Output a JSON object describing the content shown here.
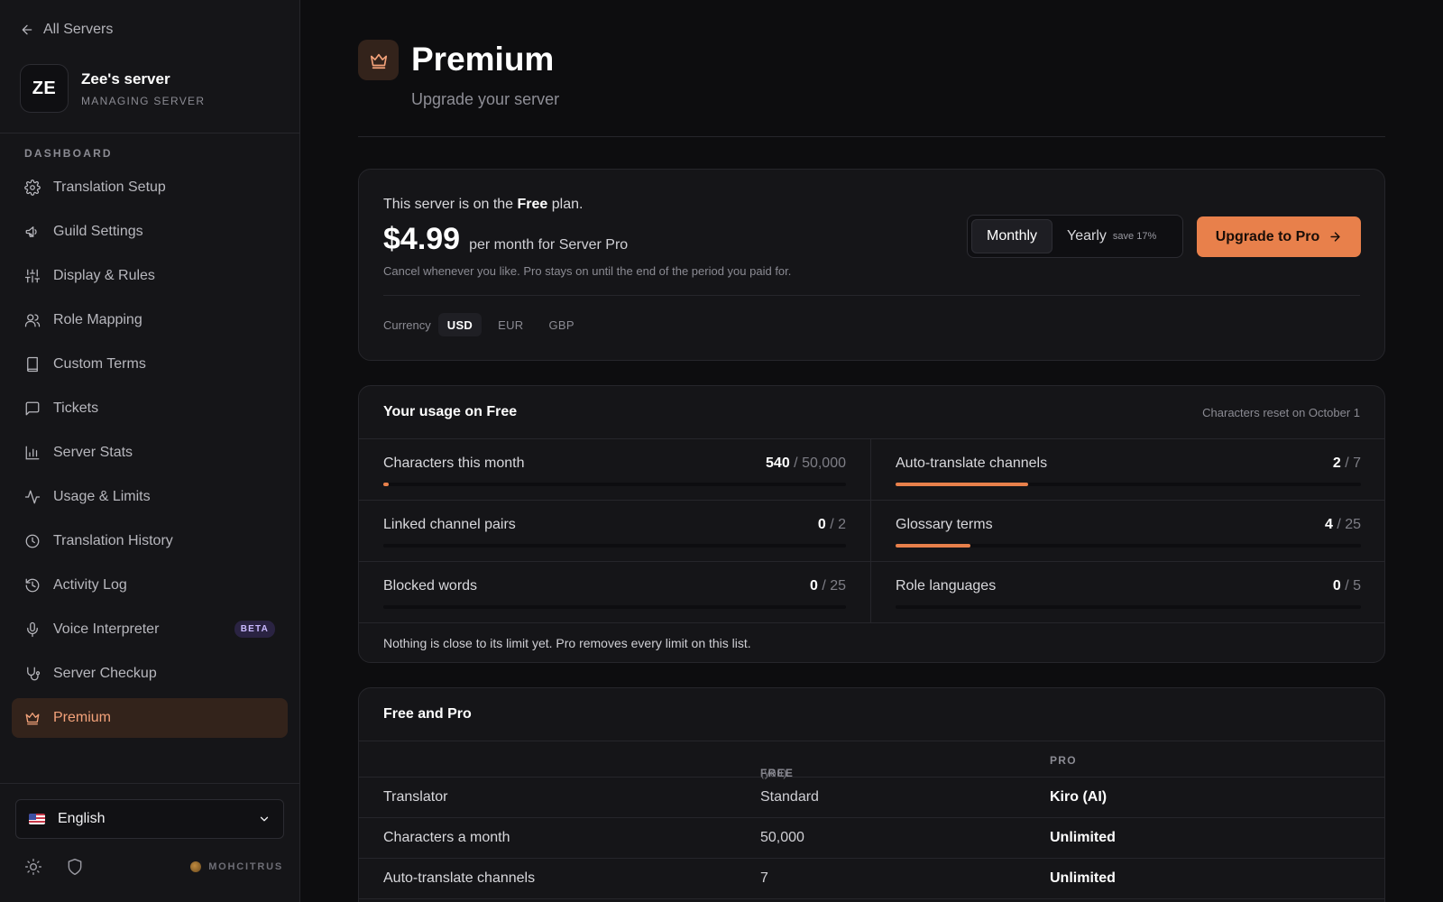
{
  "sidebar": {
    "back_label": "All Servers",
    "server_avatar": "ZE",
    "server_name": "Zee's server",
    "server_subtitle": "MANAGING SERVER",
    "section_label": "DASHBOARD",
    "items": [
      {
        "label": "Translation Setup",
        "icon": "gear-icon"
      },
      {
        "label": "Guild Settings",
        "icon": "megaphone-icon"
      },
      {
        "label": "Display & Rules",
        "icon": "sliders-icon"
      },
      {
        "label": "Role Mapping",
        "icon": "users-icon"
      },
      {
        "label": "Custom Terms",
        "icon": "book-icon"
      },
      {
        "label": "Tickets",
        "icon": "message-icon"
      },
      {
        "label": "Server Stats",
        "icon": "bar-chart-icon"
      },
      {
        "label": "Usage & Limits",
        "icon": "activity-icon"
      },
      {
        "label": "Translation History",
        "icon": "clock-icon"
      },
      {
        "label": "Activity Log",
        "icon": "history-icon"
      },
      {
        "label": "Voice Interpreter",
        "icon": "mic-icon",
        "badge": "BETA"
      },
      {
        "label": "Server Checkup",
        "icon": "stethoscope-icon"
      },
      {
        "label": "Premium",
        "icon": "crown-icon",
        "active": true
      }
    ],
    "language": "English",
    "brand": "MOHCITRUS"
  },
  "header": {
    "title": "Premium",
    "subtitle": "Upgrade your server"
  },
  "plan": {
    "line_prefix": "This server is on the ",
    "plan_name": "Free",
    "line_suffix": " plan.",
    "price": "$4.99",
    "price_note": "per month for Server Pro",
    "cancel_note": "Cancel whenever you like. Pro stays on until the end of the period you paid for.",
    "billing": {
      "monthly": "Monthly",
      "yearly": "Yearly",
      "save": "save 17%",
      "selected": "Monthly"
    },
    "upgrade_label": "Upgrade to Pro",
    "currency_label": "Currency",
    "currencies": [
      "USD",
      "EUR",
      "GBP"
    ],
    "selected_currency": "USD"
  },
  "usage": {
    "title": "Your usage on Free",
    "reset_note": "Characters reset on October 1",
    "metrics": [
      {
        "label": "Characters this month",
        "used": "540",
        "limit": "/ 50,000",
        "fraction": 0.0108
      },
      {
        "label": "Auto-translate channels",
        "used": "2",
        "limit": "/ 7",
        "fraction": 0.2857
      },
      {
        "label": "Linked channel pairs",
        "used": "0",
        "limit": "/ 2",
        "fraction": 0
      },
      {
        "label": "Glossary terms",
        "used": "4",
        "limit": "/ 25",
        "fraction": 0.16
      },
      {
        "label": "Blocked words",
        "used": "0",
        "limit": "/ 25",
        "fraction": 0
      },
      {
        "label": "Role languages",
        "used": "0",
        "limit": "/ 5",
        "fraction": 0
      }
    ],
    "footer": "Nothing is close to its limit yet. Pro removes every limit on this list."
  },
  "compare": {
    "title": "Free and Pro",
    "col_free": "FREE",
    "col_free_note": "(you)",
    "col_pro": "PRO",
    "rows": [
      {
        "feature": "Translator",
        "free": "Standard",
        "pro": "Kiro (AI)"
      },
      {
        "feature": "Characters a month",
        "free": "50,000",
        "pro": "Unlimited"
      },
      {
        "feature": "Auto-translate channels",
        "free": "7",
        "pro": "Unlimited"
      }
    ]
  },
  "colors": {
    "accent": "#e8804b",
    "accent_soft": "#33231b",
    "background": "#0d0d0f",
    "panel": "#151518"
  }
}
